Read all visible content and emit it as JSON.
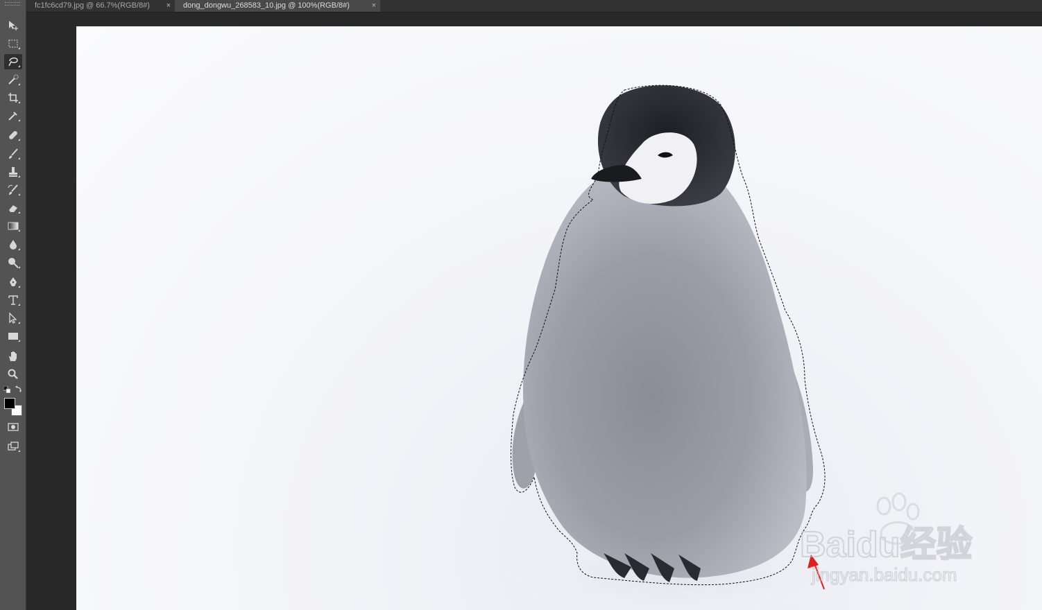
{
  "tabs": [
    {
      "label": "fc1fc6cd79.jpg @ 66.7%(RGB/8#)",
      "close": "×",
      "active": false
    },
    {
      "label": "dong_dongwu_268583_10.jpg @ 100%(RGB/8#)",
      "close": "×",
      "active": true
    }
  ],
  "toolbar": {
    "tools": [
      {
        "name": "move-tool-icon"
      },
      {
        "name": "rectangular-marquee-tool-icon"
      },
      {
        "name": "lasso-tool-icon",
        "active": true
      },
      {
        "name": "quick-selection-tool-icon"
      },
      {
        "name": "crop-tool-icon"
      },
      {
        "name": "eyedropper-tool-icon"
      },
      {
        "name": "healing-brush-tool-icon"
      },
      {
        "name": "brush-tool-icon"
      },
      {
        "name": "clone-stamp-tool-icon"
      },
      {
        "name": "history-brush-tool-icon"
      },
      {
        "name": "eraser-tool-icon"
      },
      {
        "name": "gradient-tool-icon"
      },
      {
        "name": "blur-tool-icon"
      },
      {
        "name": "dodge-tool-icon"
      },
      {
        "name": "pen-tool-icon"
      },
      {
        "name": "type-tool-icon"
      },
      {
        "name": "path-selection-tool-icon"
      },
      {
        "name": "rectangle-shape-tool-icon"
      },
      {
        "name": "hand-tool-icon"
      },
      {
        "name": "zoom-tool-icon"
      }
    ],
    "foreground_color": "#000000",
    "background_color": "#ffffff"
  },
  "colors": {
    "ui_panel": "#535353",
    "ui_dark": "#282828",
    "selection_outline": "#111111",
    "annotation_arrow": "#e0201d"
  },
  "watermark": {
    "brand": "Baidu经验",
    "url": "jingyan.baidu.com"
  }
}
